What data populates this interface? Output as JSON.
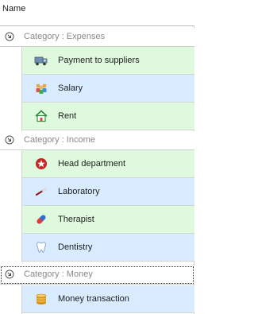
{
  "column": {
    "name": "Name"
  },
  "groups": [
    {
      "label": "Category : Expenses",
      "items": [
        {
          "label": "Payment to suppliers",
          "icon": "delivery-truck-icon"
        },
        {
          "label": "Salary",
          "icon": "people-group-icon"
        },
        {
          "label": "Rent",
          "icon": "house-icon"
        }
      ]
    },
    {
      "label": "Category : Income",
      "items": [
        {
          "label": "Head department",
          "icon": "red-star-badge-icon"
        },
        {
          "label": "Laboratory",
          "icon": "test-tube-icon"
        },
        {
          "label": "Therapist",
          "icon": "capsule-pill-icon"
        },
        {
          "label": "Dentistry",
          "icon": "tooth-icon"
        }
      ]
    },
    {
      "label": "Category : Money",
      "items": [
        {
          "label": "Money transaction",
          "icon": "coin-stack-icon"
        }
      ]
    }
  ],
  "colors": {
    "row_even": "#dff9df",
    "row_odd": "#d9ecff",
    "group_text": "#8a8a8a"
  }
}
